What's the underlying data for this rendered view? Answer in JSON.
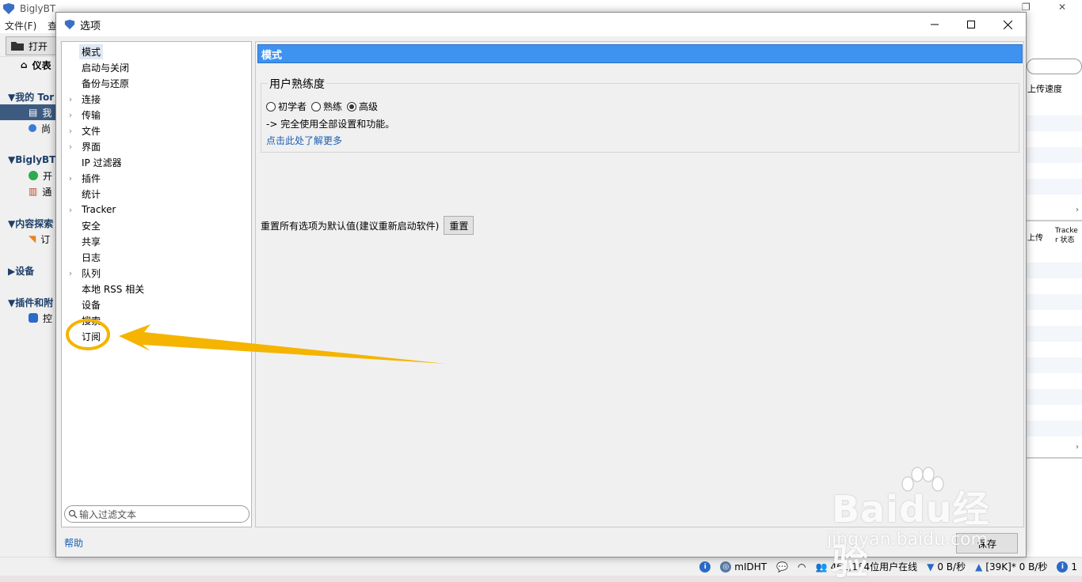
{
  "main_window": {
    "title": "BiglyBT",
    "menu": [
      "文件(F)",
      "查"
    ],
    "open_button_label": "打开",
    "tree": {
      "dashboard": "仪表",
      "my_torrents_header": "▼我的 Tor",
      "my_torrents_item": "我",
      "unfinished_item": "尚",
      "biglybt_header": "▼BiglyBT",
      "start_item": "开",
      "notify_item": "通",
      "content_header": "▼内容探索",
      "subscribe_item": "订",
      "devices_header": "▶设备",
      "plugins_header": "▼插件和附",
      "console_item": "控"
    },
    "right_columns": {
      "upload_speed": "上传速度",
      "upload": "上传",
      "tracker_status": "Tracke r 状态"
    }
  },
  "status_bar": {
    "dht": "mIDHT",
    "users_online": "461,164位用户在线",
    "down": "0 B/秒",
    "up": "[39K]* 0 B/秒",
    "count": "1"
  },
  "dialog": {
    "title": "选项",
    "nav": [
      {
        "label": "模式",
        "expandable": false,
        "selected": true
      },
      {
        "label": "启动与关闭",
        "expandable": false
      },
      {
        "label": "备份与还原",
        "expandable": false
      },
      {
        "label": "连接",
        "expandable": true
      },
      {
        "label": "传输",
        "expandable": true
      },
      {
        "label": "文件",
        "expandable": true
      },
      {
        "label": "界面",
        "expandable": true
      },
      {
        "label": "IP 过滤器",
        "expandable": false
      },
      {
        "label": "插件",
        "expandable": true
      },
      {
        "label": "统计",
        "expandable": false
      },
      {
        "label": "Tracker",
        "expandable": true
      },
      {
        "label": "安全",
        "expandable": false
      },
      {
        "label": "共享",
        "expandable": false
      },
      {
        "label": "日志",
        "expandable": false
      },
      {
        "label": "队列",
        "expandable": true
      },
      {
        "label": "本地 RSS 相关",
        "expandable": false
      },
      {
        "label": "设备",
        "expandable": false
      },
      {
        "label": "搜索",
        "expandable": false
      },
      {
        "label": "订阅",
        "expandable": false
      }
    ],
    "filter_placeholder": "输入过滤文本",
    "section_title": "模式",
    "group_title": "用户熟练度",
    "radios": [
      {
        "label": "初学者",
        "checked": false
      },
      {
        "label": "熟练",
        "checked": false
      },
      {
        "label": "高级",
        "checked": true
      }
    ],
    "mode_description": "-> 完全使用全部设置和功能。",
    "learn_more": "点击此处了解更多",
    "reset_text": "重置所有选项为默认值(建议重新启动软件)",
    "reset_button": "重置",
    "help_link": "帮助",
    "save_button": "保存"
  },
  "watermark": {
    "brand": "Baidu经验",
    "site": "jingyan.baidu.com"
  },
  "colors": {
    "section_header": "#3d93ef",
    "annotation": "#f5b400",
    "link": "#1a5fb4"
  }
}
